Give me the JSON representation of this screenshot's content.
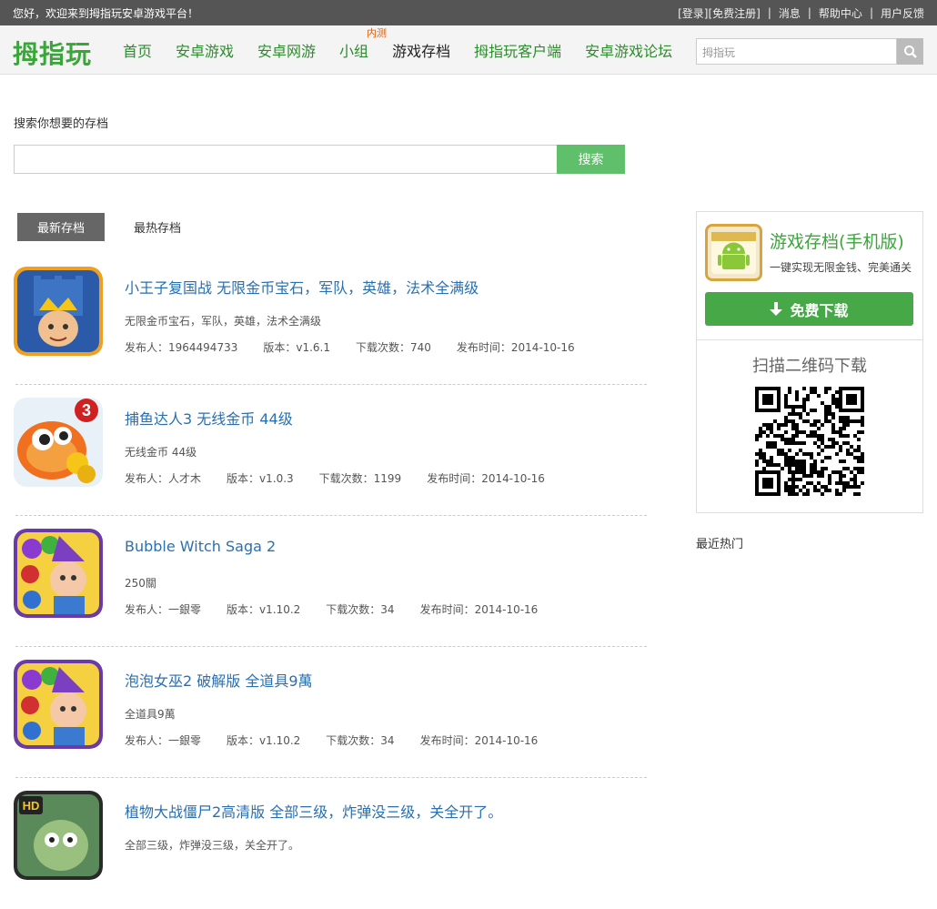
{
  "topbar": {
    "welcome": "您好，欢迎来到拇指玩安卓游戏平台！",
    "login": "[登录]",
    "register": "[免费注册]",
    "messages": "消息",
    "help": "帮助中心",
    "feedback": "用户反馈",
    "separator": "|"
  },
  "header": {
    "logo": "拇指玩",
    "nav": [
      {
        "label": "首页"
      },
      {
        "label": "安卓游戏"
      },
      {
        "label": "安卓网游"
      },
      {
        "label": "小组",
        "badge": "内测"
      },
      {
        "label": "游戏存档"
      },
      {
        "label": "拇指玩客户端"
      },
      {
        "label": "安卓游戏论坛"
      }
    ],
    "search_placeholder": "拇指玩"
  },
  "search": {
    "label": "搜索你想要的存档",
    "button": "搜索"
  },
  "tabs": [
    "最新存档",
    "最热存档"
  ],
  "items": [
    {
      "title": "小王子复国战 无限金币宝石，军队，英雄，法术全满级",
      "desc": "无限金币宝石，军队，英雄，法术全满级",
      "publisher": "发布人：1964494733",
      "version": "版本：v1.6.1",
      "downloads": "下载次数：740",
      "date": "发布时间：2014-10-16"
    },
    {
      "title": "捕鱼达人3 无线金币 44级",
      "desc": "无线金币 44级",
      "publisher": "发布人：人才木",
      "version": "版本：v1.0.3",
      "downloads": "下载次数：1199",
      "date": "发布时间：2014-10-16"
    },
    {
      "title": "Bubble Witch Saga 2",
      "desc": "250關",
      "publisher": "发布人：一銀零",
      "version": "版本：v1.10.2",
      "downloads": "下载次数：34",
      "date": "发布时间：2014-10-16"
    },
    {
      "title": "泡泡女巫2 破解版 全道具9萬",
      "desc": "全道具9萬",
      "publisher": "发布人：一銀零",
      "version": "版本：v1.10.2",
      "downloads": "下载次数：34",
      "date": "发布时间：2014-10-16"
    },
    {
      "title": "植物大战僵尸2高清版 全部三级，炸弹没三级，关全开了。",
      "desc": "全部三级，炸弹没三级，关全开了。",
      "publisher": "",
      "version": "",
      "downloads": "",
      "date": ""
    }
  ],
  "sidebar": {
    "app_title": "游戏存档(手机版)",
    "app_sub": "一键实现无限金钱、完美通关",
    "download": "免费下载",
    "qr_label": "扫描二维码下载"
  },
  "recent_label": "最近热门"
}
